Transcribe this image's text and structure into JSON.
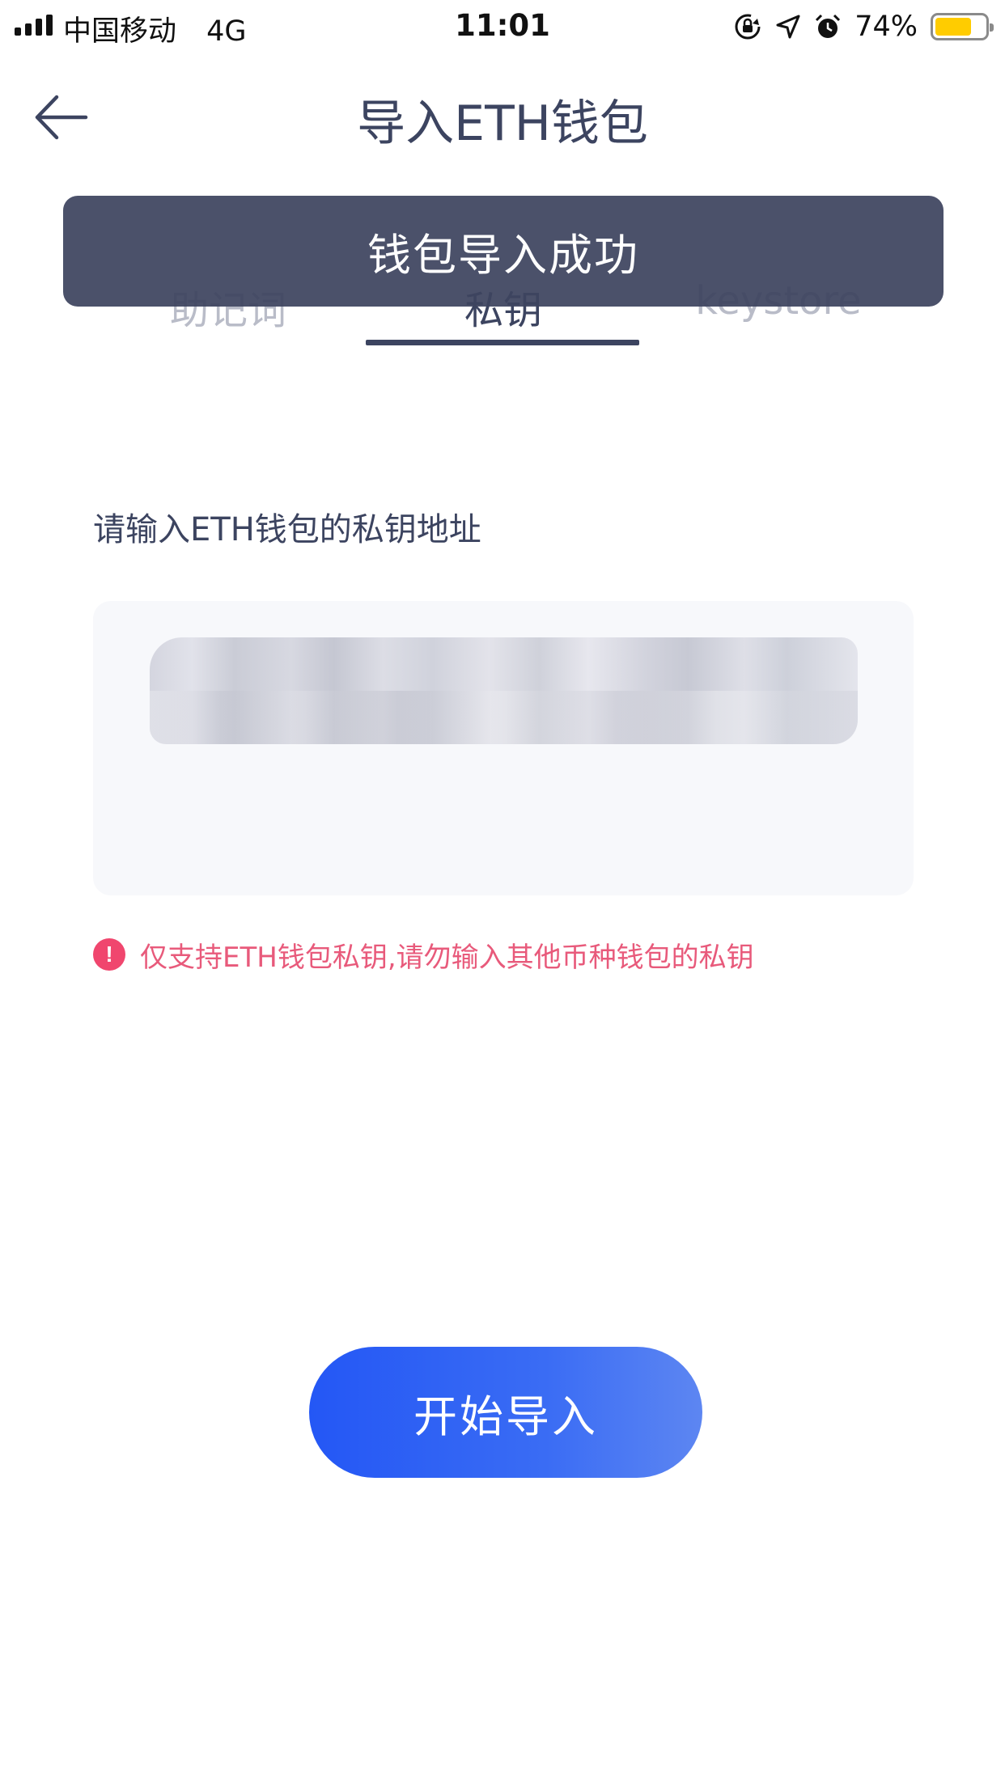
{
  "status_bar": {
    "carrier": "中国移动",
    "network": "4G",
    "time": "11:01",
    "battery_percent": "74%",
    "battery_level": 0.74,
    "icons": [
      "orientation-lock-icon",
      "location-arrow-icon",
      "alarm-clock-icon",
      "battery-icon"
    ]
  },
  "header": {
    "title": "导入ETH钱包",
    "back_icon": "arrow-left-icon"
  },
  "tabs": [
    {
      "label": "助记词",
      "active": false
    },
    {
      "label": "私钥",
      "active": true
    },
    {
      "label": "keystore",
      "active": false
    }
  ],
  "toast": {
    "message": "钱包导入成功"
  },
  "form": {
    "instruction": "请输入ETH钱包的私钥地址",
    "warning": "仅支持ETH钱包私钥,请勿输入其他币种钱包的私钥",
    "warning_icon": "exclamation-circle-icon"
  },
  "actions": {
    "start_label": "开始导入"
  },
  "colors": {
    "primary_text": "#3c4460",
    "inactive_tab": "#b9bcc8",
    "warning": "#f0466e",
    "button_start": "#2457f5",
    "button_end": "#5d86f2",
    "battery": "#ffcc00"
  }
}
